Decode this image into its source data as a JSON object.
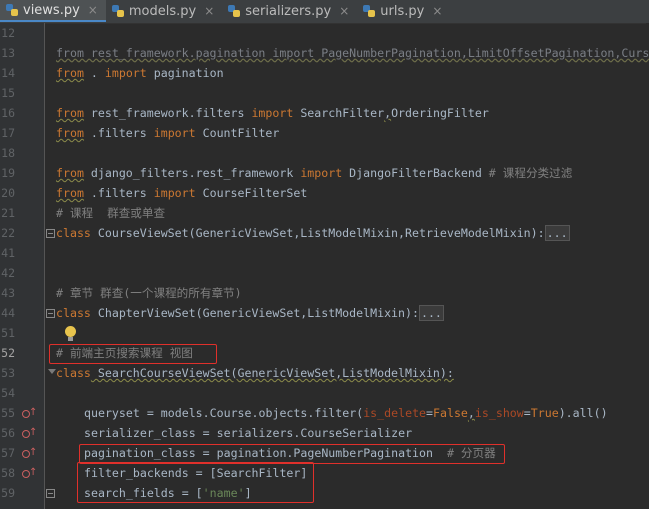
{
  "tabs": [
    {
      "label": "views.py",
      "active": true
    },
    {
      "label": "models.py",
      "active": false
    },
    {
      "label": "serializers.py",
      "active": false
    },
    {
      "label": "urls.py",
      "active": false
    }
  ],
  "tab_close_glyph": "×",
  "line_numbers": [
    "12",
    "13",
    "14",
    "15",
    "16",
    "17",
    "18",
    "19",
    "20",
    "21",
    "22",
    "41",
    "42",
    "43",
    "44",
    "51",
    "52",
    "53",
    "54",
    "55",
    "56",
    "57",
    "58",
    "59"
  ],
  "collapsed_marker": "...",
  "code": {
    "l13_text": "from rest_framework.pagination import PageNumberPagination,LimitOffsetPagination,Curs",
    "l14_kw1": "from",
    "l14_mid": " . ",
    "l14_kw2": "import",
    "l14_rest": " pagination",
    "l16_kw1": "from",
    "l16_mod": " rest_framework.filters ",
    "l16_kw2": "import",
    "l16_a": " SearchFilter",
    "l16_comma": ",",
    "l16_b": "OrderingFilter",
    "l17_kw1": "from",
    "l17_mod": " .filters ",
    "l17_kw2": "import",
    "l17_rest": " CountFilter",
    "l19_kw1": "from",
    "l19_mod": " django_filters.rest_framework ",
    "l19_kw2": "import",
    "l19_rest": " DjangoFilterBackend",
    "l19_cmt": " # 课程分类过滤",
    "l20_kw1": "from",
    "l20_mod": " .filters ",
    "l20_kw2": "import",
    "l20_rest": " CourseFilterSet",
    "l21_cmt": "# 课程  群查或单查",
    "l22_kw": "class",
    "l22_rest": " CourseViewSet(GenericViewSet,ListModelMixin,RetrieveModelMixin):",
    "l43_cmt": "# 章节 群查(一个课程的所有章节)",
    "l44_kw": "class",
    "l44_rest": " ChapterViewSet(GenericViewSet,ListModelMixin):",
    "l52_cmt": "# 前端主页搜索课程 视图",
    "l53_kw": "class",
    "l53_rest": " SearchCourseViewSet(GenericViewSet,ListModelMixin):",
    "l55_a": "queryset = models.Course.objects.filter(",
    "l55_p1": "is_delete",
    "l55_eq1": "=",
    "l55_v1": "False",
    "l55_c": ",",
    "l55_p2": "is_show",
    "l55_eq2": "=",
    "l55_v2": "True",
    "l55_end": ").all()",
    "l56_text": "serializer_class = serializers.CourseSerializer",
    "l57_text": "pagination_class = pagination.PageNumberPagination",
    "l57_cmt": "  # 分页器",
    "l58_text": "filter_backends = [SearchFilter]",
    "l59_a": "search_fields = [",
    "l59_str": "'name'",
    "l59_b": "]"
  },
  "colors": {
    "background": "#2b2b2b",
    "keyword": "#cc7832",
    "comment": "#808080",
    "string": "#6a8759",
    "highlight_box": "#e0302b"
  },
  "icons": [
    "python-file-icon",
    "override-method-icon",
    "fold-icon",
    "lightbulb-icon"
  ]
}
